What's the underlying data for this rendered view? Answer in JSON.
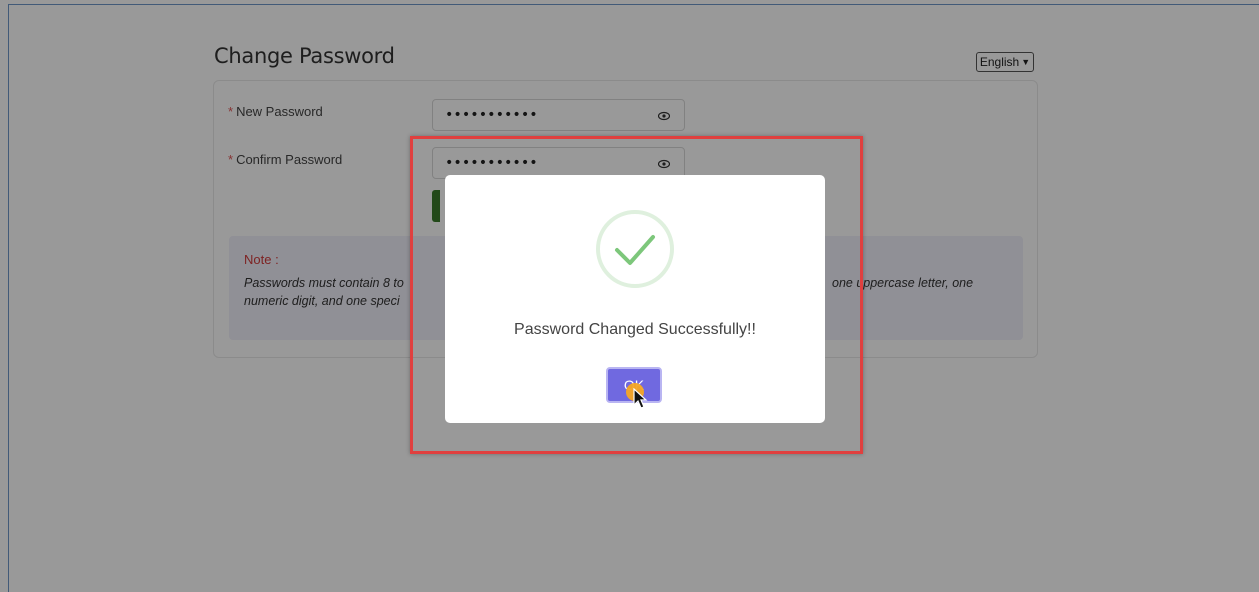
{
  "page": {
    "title": "Change Password",
    "language": {
      "selected": "English"
    }
  },
  "form": {
    "new_password": {
      "label": "New Password",
      "value": "•••••••••••"
    },
    "confirm_password": {
      "label": "Confirm Password",
      "value": "•••••••••••"
    },
    "required_marker": "*"
  },
  "note": {
    "title": "Note :",
    "text_line1_left": "Passwords must contain 8 to",
    "text_line1_right": "one uppercase letter, one",
    "text_line2_left": "numeric digit, and one speci"
  },
  "dialog": {
    "message": "Password Changed Successfully!!",
    "ok_label": "OK",
    "icon": "check-circle-icon"
  },
  "colors": {
    "accent": "#7069e0",
    "highlight": "#e0403f",
    "note_title": "#d23b3b",
    "success": "#7dc77b"
  }
}
